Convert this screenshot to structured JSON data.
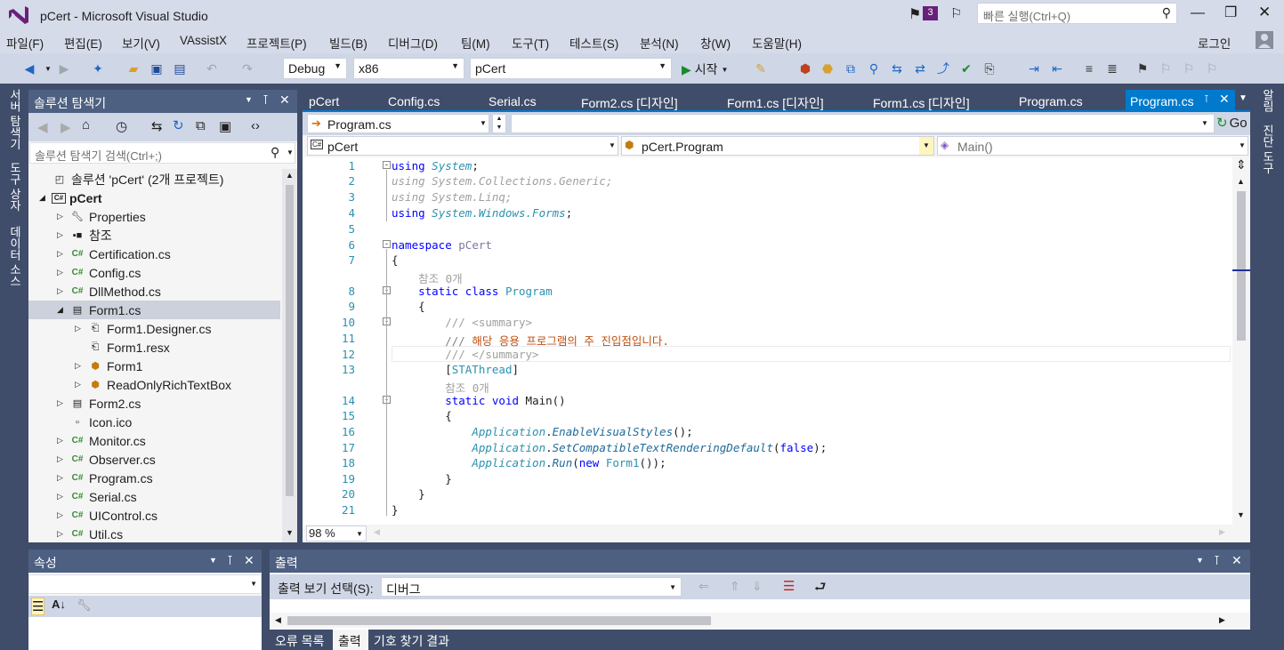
{
  "window": {
    "title": "pCert - Microsoft Visual Studio",
    "notif_count": "3",
    "quicklaunch_placeholder": "빠른 실행(Ctrl+Q)",
    "login": "로그인"
  },
  "menu": [
    "파일(F)",
    "편집(E)",
    "보기(V)",
    "VAssistX",
    "프로젝트(P)",
    "빌드(B)",
    "디버그(D)",
    "팀(M)",
    "도구(T)",
    "테스트(S)",
    "분석(N)",
    "창(W)",
    "도움말(H)"
  ],
  "toolbar": {
    "config": "Debug",
    "platform": "x86",
    "startup": "pCert",
    "start_label": "시작"
  },
  "left_vtabs": [
    "서버 탐색기",
    "도구 상자",
    "데이터 소스"
  ],
  "right_vtabs": [
    "알림",
    "진단 도구"
  ],
  "solution_explorer": {
    "title": "솔루션 탐색기",
    "search_placeholder": "솔루션 탐색기 검색(Ctrl+;)",
    "items": [
      {
        "label": "솔루션 'pCert' (2개 프로젝트)",
        "icon": "solution-icon"
      },
      {
        "label": "pCert",
        "icon": "csharp-project-icon"
      },
      {
        "label": "Properties",
        "icon": "wrench-icon"
      },
      {
        "label": "참조",
        "icon": "references-icon"
      },
      {
        "label": "Certification.cs",
        "icon": "csharp-file-icon"
      },
      {
        "label": "Config.cs",
        "icon": "csharp-file-icon"
      },
      {
        "label": "DllMethod.cs",
        "icon": "csharp-file-icon"
      },
      {
        "label": "Form1.cs",
        "icon": "form-icon"
      },
      {
        "label": "Form1.Designer.cs",
        "icon": "designer-file-icon"
      },
      {
        "label": "Form1.resx",
        "icon": "resx-file-icon"
      },
      {
        "label": "Form1",
        "icon": "class-icon"
      },
      {
        "label": "ReadOnlyRichTextBox",
        "icon": "class-icon"
      },
      {
        "label": "Form2.cs",
        "icon": "form-icon"
      },
      {
        "label": "Icon.ico",
        "icon": "ico-file-icon"
      },
      {
        "label": "Monitor.cs",
        "icon": "csharp-file-icon"
      },
      {
        "label": "Observer.cs",
        "icon": "csharp-file-icon"
      },
      {
        "label": "Program.cs",
        "icon": "csharp-file-icon"
      },
      {
        "label": "Serial.cs",
        "icon": "csharp-file-icon"
      },
      {
        "label": "UIControl.cs",
        "icon": "csharp-file-icon"
      },
      {
        "label": "Util.cs",
        "icon": "csharp-file-icon"
      }
    ]
  },
  "editor": {
    "tabs": [
      "pCert",
      "Config.cs",
      "Serial.cs",
      "Form2.cs [디자인]",
      "Form1.cs [디자인]",
      "Form1.cs [디자인]",
      "Program.cs",
      "Program.cs"
    ],
    "file_combo": "Program.cs",
    "go_label": "Go",
    "project_combo": "pCert",
    "class_combo": "pCert.Program",
    "member_combo": "Main()",
    "zoom": "98 %",
    "lines": [
      {
        "n": "1",
        "t": "using System;"
      },
      {
        "n": "2",
        "t": "using System.Collections.Generic;"
      },
      {
        "n": "3",
        "t": "using System.Linq;"
      },
      {
        "n": "4",
        "t": "using System.Windows.Forms;"
      },
      {
        "n": "5",
        "t": ""
      },
      {
        "n": "6",
        "t": "namespace pCert"
      },
      {
        "n": "7",
        "t": "{"
      },
      {
        "n": "",
        "t": "    참조 0개"
      },
      {
        "n": "8",
        "t": "    static class Program"
      },
      {
        "n": "9",
        "t": "    {"
      },
      {
        "n": "10",
        "t": "        /// <summary>"
      },
      {
        "n": "11",
        "t": "        /// 해당 응용 프로그램의 주 진입점입니다."
      },
      {
        "n": "12",
        "t": "        /// </summary>"
      },
      {
        "n": "13",
        "t": "        [STAThread]"
      },
      {
        "n": "",
        "t": "        참조 0개"
      },
      {
        "n": "14",
        "t": "        static void Main()"
      },
      {
        "n": "15",
        "t": "        {"
      },
      {
        "n": "16",
        "t": "            Application.EnableVisualStyles();"
      },
      {
        "n": "17",
        "t": "            Application.SetCompatibleTextRenderingDefault(false);"
      },
      {
        "n": "18",
        "t": "            Application.Run(new Form1());"
      },
      {
        "n": "19",
        "t": "        }"
      },
      {
        "n": "20",
        "t": "    }"
      },
      {
        "n": "21",
        "t": "}"
      }
    ]
  },
  "properties": {
    "title": "속성"
  },
  "output": {
    "title": "출력",
    "select_label": "출력 보기 선택(S):",
    "select_value": "디버그",
    "tabs": [
      "오류 목록",
      "출력",
      "기호 찾기 결과"
    ]
  },
  "colors": {
    "accent": "#007acc",
    "keyword": "#0000ff",
    "type": "#2b91af",
    "comment": "#008000",
    "string": "#a31515"
  }
}
